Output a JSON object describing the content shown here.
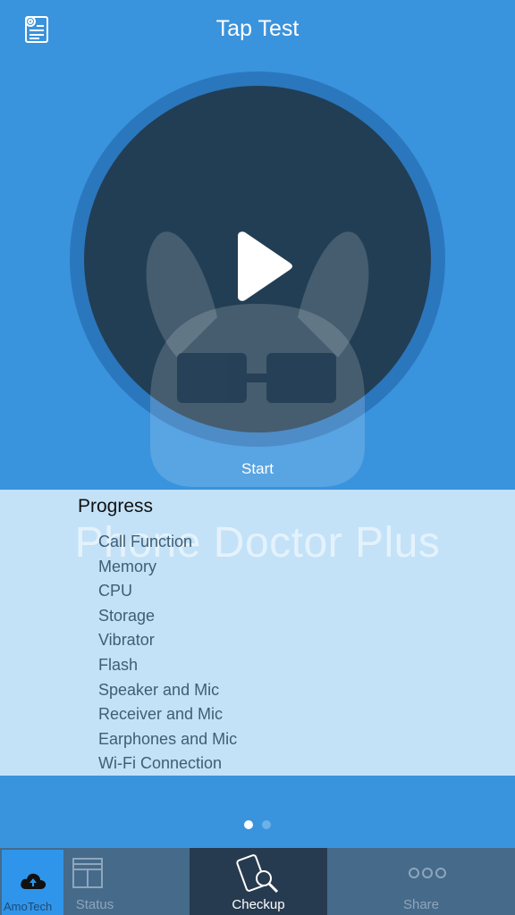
{
  "header": {
    "title": "Tap Test",
    "doc_icon": "certificate-document-icon"
  },
  "hero": {
    "play_icon": "play-icon",
    "mascot": "bunny-with-glasses-icon",
    "start_label": "Start"
  },
  "progress": {
    "heading": "Progress",
    "watermark": "Phone Doctor Plus",
    "items": [
      "Call Function",
      "Memory",
      "CPU",
      "Storage",
      "Vibrator",
      "Flash",
      "Speaker and Mic",
      "Receiver and Mic",
      "Earphones and Mic",
      "Wi-Fi Connection"
    ]
  },
  "pager": {
    "pages": 2,
    "current": 1
  },
  "tabbar": {
    "upload_icon": "cloud-upload-icon",
    "brand_watermark": "AmoTech",
    "tabs": [
      {
        "label": "Status",
        "icon": "status-grid-icon"
      },
      {
        "label": "Checkup",
        "icon": "phone-magnifier-icon"
      },
      {
        "label": "Share",
        "icon": "dots-icon"
      }
    ]
  },
  "colors": {
    "background": "#3a93dd",
    "disc": "#223e54",
    "ring": "#2b77bd",
    "progress_panel": "#c3e2f8",
    "tabbar": "#466a8a",
    "tab_active": "#273b50"
  }
}
